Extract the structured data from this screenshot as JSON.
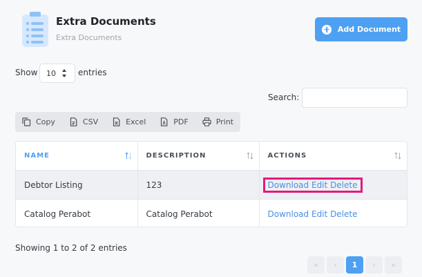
{
  "header": {
    "title": "Extra Documents",
    "subtitle": "Extra Documents",
    "add_button": "Add Document",
    "icon": "clipboard-icon"
  },
  "length": {
    "show": "Show",
    "value": "10",
    "entries": "entries"
  },
  "search": {
    "label": "Search:",
    "value": "",
    "placeholder": ""
  },
  "export_buttons": [
    "Copy",
    "CSV",
    "Excel",
    "PDF",
    "Print"
  ],
  "table": {
    "columns": [
      "NAME",
      "DESCRIPTION",
      "ACTIONS"
    ],
    "rows": [
      {
        "name": "Debtor Listing",
        "description": "123",
        "actions": [
          "Download",
          "Edit",
          "Delete"
        ]
      },
      {
        "name": "Catalog Perabot",
        "description": "Catalog Perabot",
        "actions": [
          "Download",
          "Edit",
          "Delete"
        ]
      }
    ]
  },
  "info": "Showing 1 to 2 of 2 entries",
  "pagination": {
    "first": "«",
    "prev": "‹",
    "current": "1",
    "next": "›",
    "last": "»"
  },
  "colors": {
    "accent": "#4ea0f2",
    "highlight_border": "#e5197d",
    "link": "#4a90e2"
  }
}
